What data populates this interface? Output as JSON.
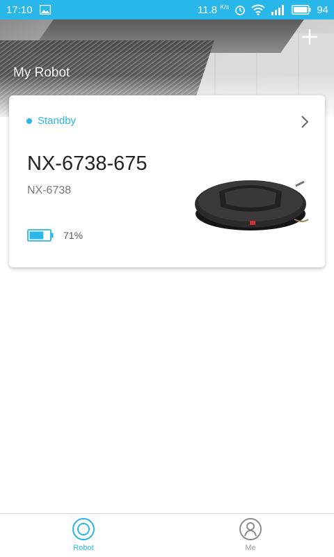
{
  "status_bar": {
    "time": "17:10",
    "speed_value": "11.8",
    "speed_unit": "K/s",
    "battery": "94"
  },
  "header": {
    "title": "My Robot",
    "add_icon": "plus-icon"
  },
  "robot_card": {
    "status": "Standby",
    "name": "NX-6738-675",
    "model": "NX-6738",
    "battery_percent": "71%",
    "battery_level": 0.71,
    "chevron_icon": "chevron-right-icon"
  },
  "tabs": [
    {
      "label": "Robot",
      "icon": "robot-icon",
      "active": true
    },
    {
      "label": "Me",
      "icon": "person-icon",
      "active": false
    }
  ],
  "colors": {
    "accent": "#29b6e8",
    "status_bar": "#29b6e8"
  }
}
